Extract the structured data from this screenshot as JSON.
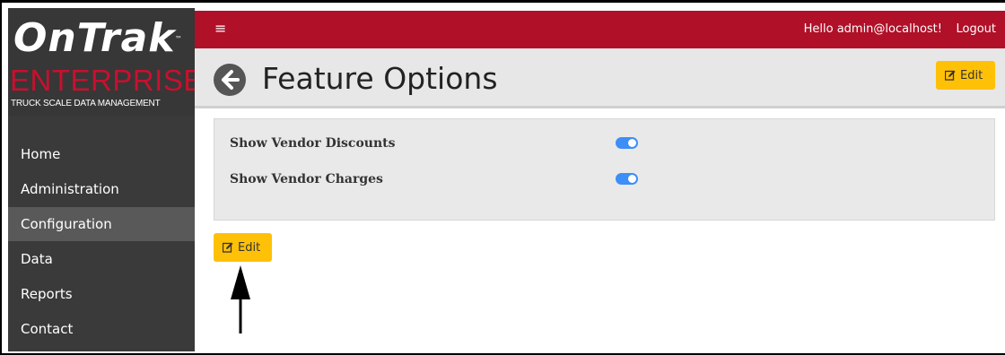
{
  "logo": {
    "brand": "OnTrak",
    "tm": "™",
    "product": "ENTERPRISE",
    "tagline": "TRUCK SCALE DATA MANAGEMENT"
  },
  "sidebar": {
    "items": [
      {
        "label": "Home",
        "active": false
      },
      {
        "label": "Administration",
        "active": false
      },
      {
        "label": "Configuration",
        "active": true
      },
      {
        "label": "Data",
        "active": false
      },
      {
        "label": "Reports",
        "active": false
      },
      {
        "label": "Contact",
        "active": false
      }
    ]
  },
  "topbar": {
    "menu_icon": "hamburger-icon",
    "greeting": "Hello admin@localhost!",
    "logout_label": "Logout"
  },
  "header": {
    "back_icon": "arrow-left-circle-icon",
    "title": "Feature Options",
    "edit_label": "Edit"
  },
  "options": [
    {
      "label": "Show Vendor Discounts",
      "enabled": true
    },
    {
      "label": "Show Vendor Charges",
      "enabled": true
    }
  ],
  "footer": {
    "edit_label": "Edit"
  },
  "colors": {
    "topbar": "#b01028",
    "sidebar": "#3a3a3a",
    "sidebar_active": "#595959",
    "edit_button": "#ffc107",
    "toggle_on": "#3d8ef7",
    "brand_red": "#c8102e"
  }
}
